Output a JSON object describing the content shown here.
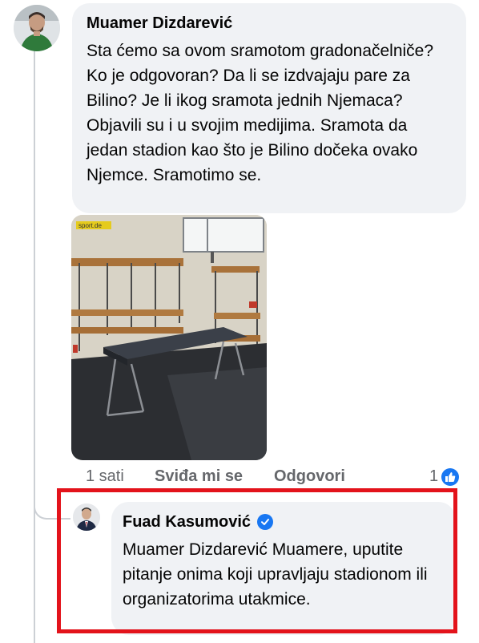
{
  "comment": {
    "author": "Muamer Dizdarević",
    "text": "Sta ćemo sa ovom sramotom gradonačelniče? Ko je odgovoran? Da li se izdvajaju pare za Bilino? Je li ikog sramota jednih Njemaca? Objavili su i u svojim medijima. Sramota da jedan stadion kao što je Bilino dočeka ovako Njemce. Sramotimo se.",
    "photo_watermark": "sport.de",
    "time": "1 sati",
    "like_label": "Sviđa mi se",
    "reply_label": "Odgovori",
    "like_count": "1"
  },
  "reply": {
    "author": "Fuad Kasumović",
    "text": "Muamer Dizdarević Muamere, uputite pitanje onima koji upravljaju stadionom ili organizatorima utakmice.",
    "verified": true
  },
  "colors": {
    "bubble": "#f0f2f5",
    "accent": "#1877f2",
    "muted": "#65676b",
    "highlight": "#e3131b"
  },
  "icons": [
    "avatar",
    "verified-badge-icon",
    "like-reaction-icon"
  ]
}
